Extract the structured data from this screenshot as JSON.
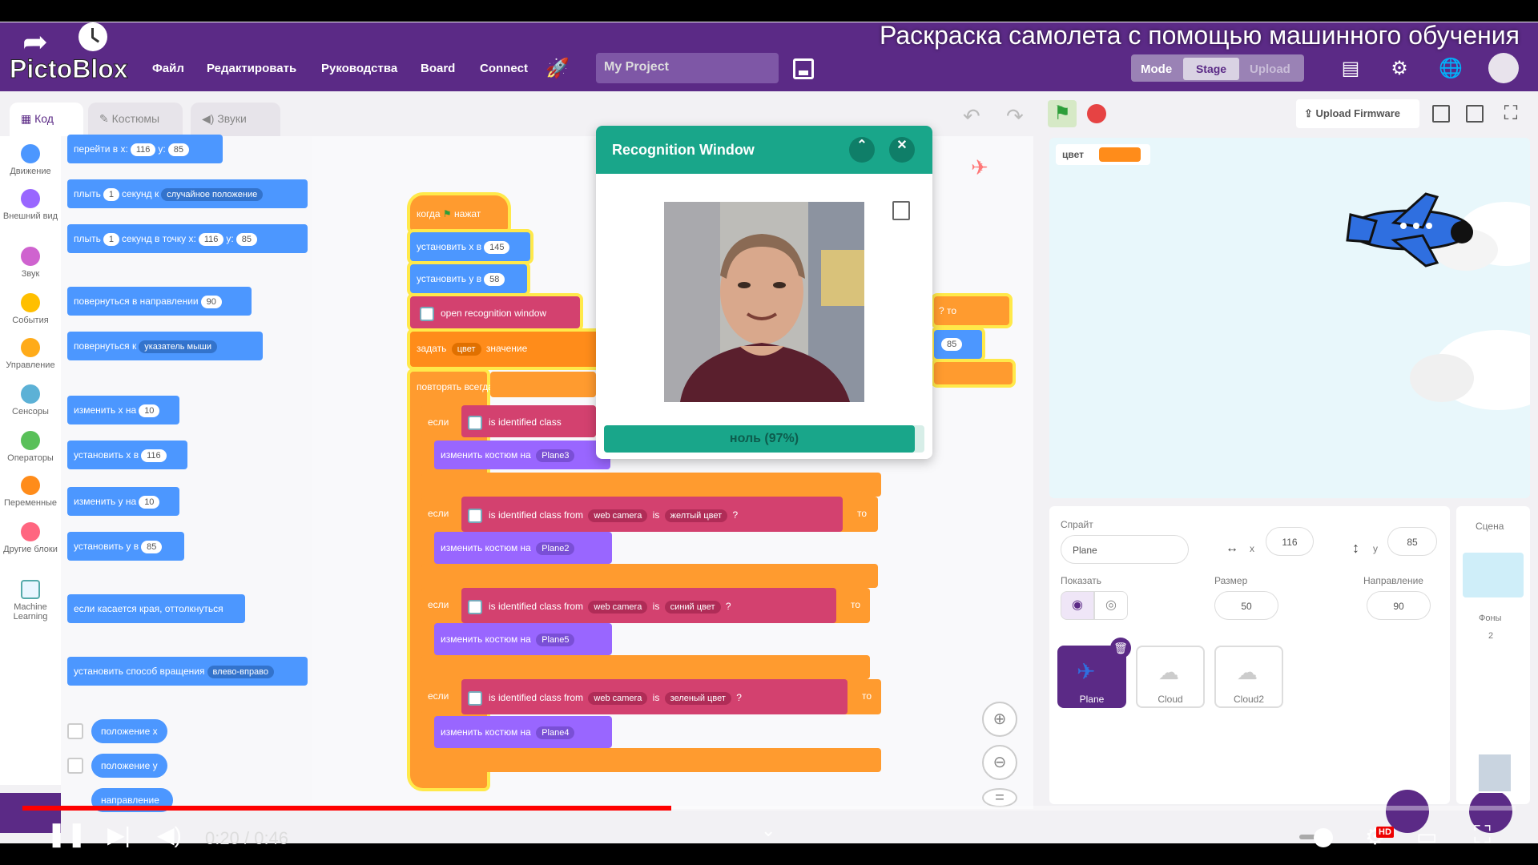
{
  "video": {
    "title": "Раскраска самолета с помощью машинного обучения",
    "time_current": "0:20",
    "time_separator": "/",
    "time_total": "0:46",
    "progress": 0.4348,
    "hd_badge": "HD"
  },
  "app": {
    "logo": "PictoBlox",
    "menu": [
      "Файл",
      "Редактировать",
      "Руководства",
      "Board",
      "Connect"
    ],
    "project_name": "My Project",
    "mode_label": "Mode",
    "stage_label": "Stage",
    "upload_label": "Upload",
    "accent": "#5b2a86"
  },
  "tabs": [
    "Код",
    "Костюмы",
    "Звуки"
  ],
  "toolbar": {
    "upload_firmware": "Upload Firmware"
  },
  "categories": [
    {
      "label": "Движение",
      "color": "#4c97ff"
    },
    {
      "label": "Внешний вид",
      "color": "#9966ff"
    },
    {
      "label": "Звук",
      "color": "#cf63cf"
    },
    {
      "label": "События",
      "color": "#ffbf00"
    },
    {
      "label": "Управление",
      "color": "#ffab19"
    },
    {
      "label": "Сенсоры",
      "color": "#5cb1d6"
    },
    {
      "label": "Операторы",
      "color": "#59c059"
    },
    {
      "label": "Переменные",
      "color": "#ff8c1a"
    },
    {
      "label": "Другие блоки",
      "color": "#ff6680"
    },
    {
      "label": "Machine Learning",
      "color": "#5fa"
    }
  ],
  "palette": {
    "goto_xy": {
      "text": "перейти в х:",
      "x": "116",
      "y_label": "y:",
      "y": "85"
    },
    "glide_random": {
      "pre": "плыть",
      "secs": "1",
      "mid": "секунд к",
      "target": "случайное положение"
    },
    "glide_xy": {
      "pre": "плыть",
      "secs": "1",
      "mid": "секунд в точку х:",
      "x": "116",
      "y_label": "y:",
      "y": "85"
    },
    "point_dir": {
      "text": "повернуться в направлении",
      "val": "90"
    },
    "point_towards": {
      "text": "повернуться к",
      "target": "указатель мыши"
    },
    "change_x": {
      "text": "изменить х на",
      "val": "10"
    },
    "set_x": {
      "text": "установить х в",
      "val": "116"
    },
    "change_y": {
      "text": "изменить у на",
      "val": "10"
    },
    "set_y": {
      "text": "установить у в",
      "val": "85"
    },
    "bounce": {
      "text": "если касается края, оттолкнуться"
    },
    "rotation_style": {
      "text": "установить способ вращения",
      "val": "влево-вправо"
    },
    "reporters": [
      "положение х",
      "положение у",
      "направление"
    ]
  },
  "script": {
    "hat": "когда",
    "hat_suffix": "нажат",
    "set_x": {
      "text": "установить х в",
      "val": "145"
    },
    "set_y": {
      "text": "установить у в",
      "val": "58"
    },
    "open_window": "open recognition window",
    "set_var": {
      "pre": "задать",
      "var": "цвет",
      "mid": "значение"
    },
    "forever": "повторять всегда",
    "if_label": "если",
    "then_label": "то",
    "identified_first": "is identified class",
    "identified": "is identified class from",
    "camera": "web camera",
    "is_label": "is",
    "q": "?",
    "colors": [
      "желтый цвет",
      "синий цвет",
      "зеленый цвет"
    ],
    "switch_costume": "изменить костюм на",
    "costumes": [
      "Plane3",
      "Plane2",
      "Plane5",
      "Plane4"
    ],
    "right_frag": {
      "q": "?",
      "then": "то",
      "val": "85"
    }
  },
  "recognition": {
    "title": "Recognition Window",
    "result": "ноль (97%)",
    "confidence": 0.97
  },
  "stage": {
    "variable_name": "цвет",
    "variable_color": "#ff8c1a"
  },
  "sprite": {
    "sprite_label": "Спрайт",
    "name": "Plane",
    "x_label": "x",
    "x": "116",
    "y_label": "y",
    "y": "85",
    "show_label": "Показать",
    "size_label": "Размер",
    "size": "50",
    "direction_label": "Направление",
    "direction": "90",
    "sprites": [
      "Plane",
      "Cloud",
      "Cloud2"
    ],
    "scene_label": "Сцена",
    "backdrops_label": "Фоны",
    "backdrops_count": "2"
  }
}
